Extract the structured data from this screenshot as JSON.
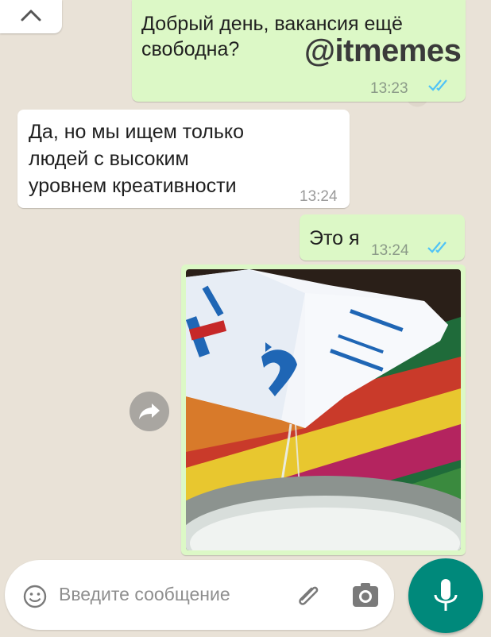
{
  "watermark": "@itmemes",
  "messages": [
    {
      "text_line1": "Добрый день, вакансия ещё",
      "text_line2": "свободна?",
      "time": "13:23"
    },
    {
      "text_line1": "Да, но мы ищем только",
      "text_line2": "людей с высоким",
      "text_line3": "уровнем креативности",
      "time": "13:24"
    },
    {
      "text": "Это я",
      "time": "13:24"
    }
  ],
  "input": {
    "placeholder": "Введите сообщение"
  },
  "icons": [
    "chevron-up-icon",
    "double-check-icon",
    "forward-icon",
    "emoji-icon",
    "attach-icon",
    "camera-icon",
    "mic-icon"
  ],
  "colors": {
    "outgoing": "#dcf8c6",
    "incoming": "#ffffff",
    "ticks": "#4fc3f7",
    "accent": "#00897b",
    "wallpaper": "#e9e2d7"
  }
}
